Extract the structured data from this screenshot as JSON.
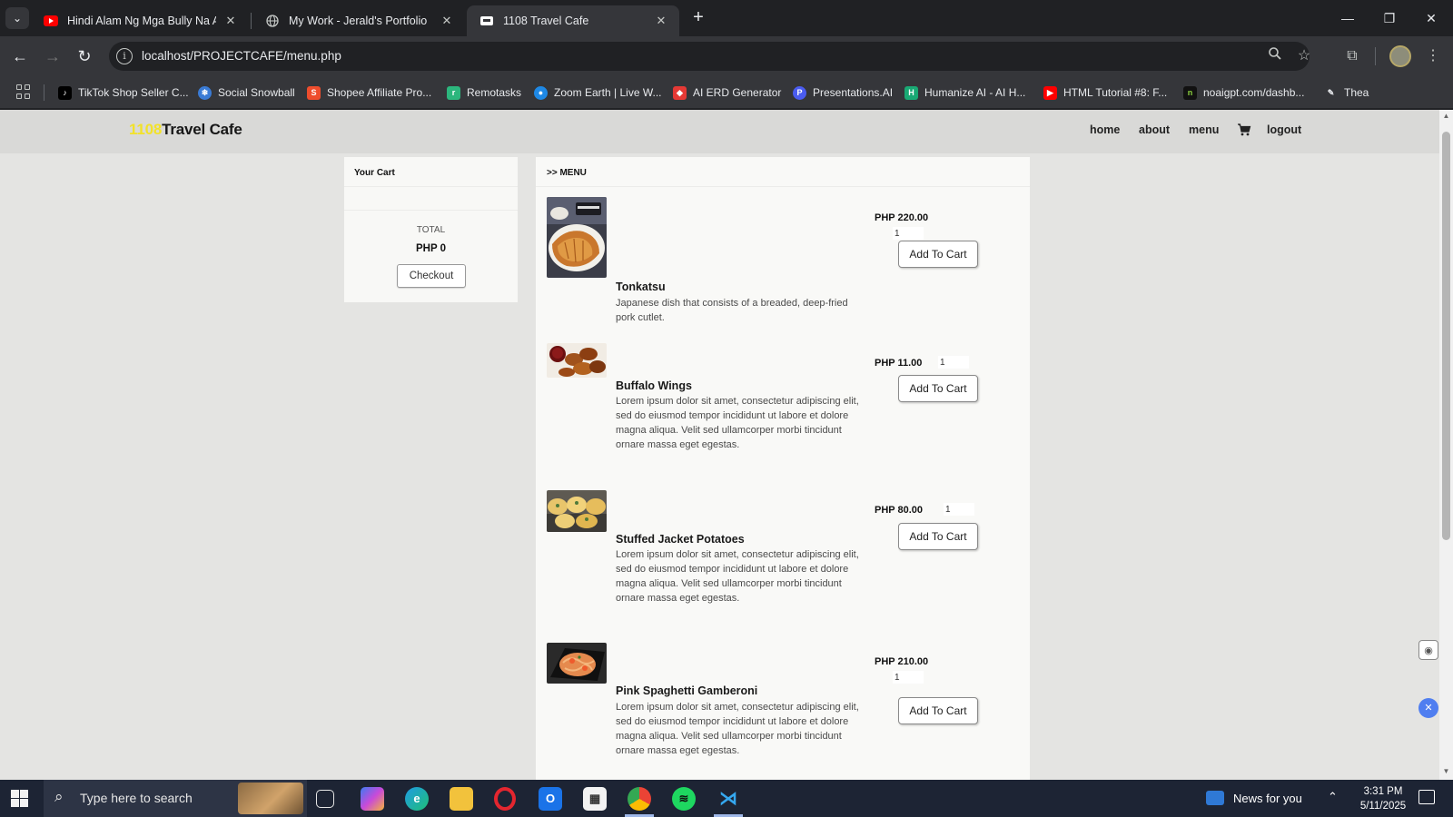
{
  "browser": {
    "tabs": [
      {
        "label": "Hindi Alam Ng Mga Bully Na A",
        "favicon": "youtube-icon",
        "active": false
      },
      {
        "label": "My Work - Jerald's Portfolio",
        "favicon": "globe-icon",
        "active": false
      },
      {
        "label": "1108 Travel Cafe",
        "favicon": "cafe-icon",
        "active": true
      }
    ],
    "new_tab": "+",
    "url": "localhost/PROJECTCAFE/menu.php",
    "bookmarks": [
      {
        "label": "TikTok Shop Seller C...",
        "color": "#000000"
      },
      {
        "label": "Social Snowball",
        "color": "#3a7bd5"
      },
      {
        "label": "Shopee Affiliate Pro...",
        "color": "#ee4d2d"
      },
      {
        "label": "Remotasks",
        "color": "#2cb67d"
      },
      {
        "label": "Zoom Earth | Live W...",
        "color": "#1e88e5"
      },
      {
        "label": "AI ERD Generator",
        "color": "#e53935"
      },
      {
        "label": "Presentations.AI",
        "color": "#4a5cf0"
      },
      {
        "label": "Humanize AI - AI H...",
        "color": "#19a974"
      },
      {
        "label": "HTML Tutorial #8: F...",
        "color": "#ff0000"
      },
      {
        "label": "noaigpt.com/dashb...",
        "color": "#111111"
      },
      {
        "label": "Thea",
        "color": "#888888"
      }
    ]
  },
  "site": {
    "brand_number": "1108",
    "brand_name": "Travel Cafe",
    "brand_accent": "#f2e22a",
    "nav": [
      "home",
      "about",
      "menu",
      "logout"
    ]
  },
  "cart": {
    "title": "Your Cart",
    "total_label": "TOTAL",
    "total_value": "PHP 0",
    "checkout_label": "Checkout"
  },
  "menu": {
    "heading": ">> MENU",
    "add_label": "Add To Cart",
    "items": [
      {
        "name": "Tonkatsu",
        "desc": "Japanese dish that consists of a breaded, deep-fried pork cutlet.",
        "price": "PHP 220.00",
        "qty": "1"
      },
      {
        "name": "Buffalo Wings",
        "desc": "Lorem ipsum dolor sit amet, consectetur adipiscing elit, sed do eiusmod tempor incididunt ut labore et dolore magna aliqua. Velit sed ullamcorper morbi tincidunt ornare massa eget egestas.",
        "price": "PHP 11.00",
        "qty": "1"
      },
      {
        "name": "Stuffed Jacket Potatoes",
        "desc": "Lorem ipsum dolor sit amet, consectetur adipiscing elit, sed do eiusmod tempor incididunt ut labore et dolore magna aliqua. Velit sed ullamcorper morbi tincidunt ornare massa eget egestas.",
        "price": "PHP 80.00",
        "qty": "1"
      },
      {
        "name": "Pink Spaghetti Gamberoni",
        "desc": "Lorem ipsum dolor sit amet, consectetur adipiscing elit, sed do eiusmod tempor incididunt ut labore et dolore magna aliqua. Velit sed ullamcorper morbi tincidunt ornare massa eget egestas.",
        "price": "PHP 210.00",
        "qty": "1"
      }
    ]
  },
  "taskbar": {
    "search_placeholder": "Type here to search",
    "news": "News for you",
    "time": "3:31 PM",
    "date": "5/11/2025"
  }
}
